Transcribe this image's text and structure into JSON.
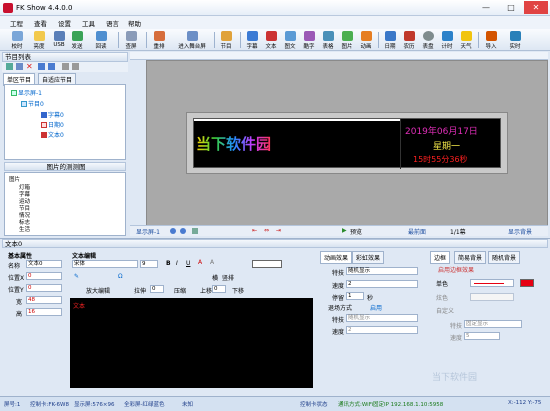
{
  "window": {
    "title": "FK Show 4.4.0.0",
    "min": "—",
    "max": "□",
    "close": "✕"
  },
  "menu": [
    "工程",
    "查看",
    "设置",
    "工具",
    "语言",
    "帮助"
  ],
  "toolbar": [
    "校时",
    "亮度",
    "USB",
    "发送",
    "回读",
    "查屏",
    "重排",
    "进入舞台屏",
    "节目",
    "字幕",
    "文本",
    "图文",
    "酷字",
    "表格",
    "图片",
    "动画",
    "日期",
    "农历",
    "表盘",
    "计时",
    "天气",
    "导入",
    "实时"
  ],
  "left_panel": {
    "title": "节目列表",
    "tabs": [
      "单区节目",
      "自适应节目"
    ]
  },
  "tree": {
    "root": "显示屏-1",
    "program": "节目0",
    "items": [
      "字幕0",
      "日期0",
      "文本0"
    ]
  },
  "list2": {
    "title": "图片的测测图",
    "root": "图片",
    "items": [
      "灯箱",
      "字幕",
      "运动",
      "节目",
      "情况",
      "标志",
      "生活",
      "其他"
    ]
  },
  "screen": {
    "main_text": "当下软件园",
    "date": "2019年06月17日",
    "weekday": "星期一",
    "time": "15时55分36秒"
  },
  "canvas_bar": {
    "screen_label": "显示屏-1",
    "preview": "预览",
    "page": "1/1幕",
    "bg": "显示背景",
    "front": "最前面"
  },
  "text_panel": {
    "title": "文本0",
    "basic": "基本属性",
    "name_label": "名称",
    "name_value": "文本0",
    "pos_x_label": "位置X",
    "pos_x": "0",
    "pos_y_label": "位置Y",
    "pos_y": "0",
    "width_label": "宽",
    "width": "48",
    "height_label": "高",
    "height": "16"
  },
  "editor": {
    "title": "文本编辑",
    "font": "宋体",
    "size": "9",
    "bg_label": "横",
    "flip": "竖排",
    "expand": "放大编辑",
    "stretch": "拉伸",
    "shrink": "压缩",
    "up": "上移",
    "down": "下移",
    "val0": "0",
    "val1": "0",
    "content": "文本"
  },
  "effects": {
    "tabs": [
      "动画效果",
      "彩虹效果"
    ],
    "effect_label": "特技",
    "effect_value": "随机显示",
    "speed_label": "速度",
    "speed_value": "2",
    "stay_label": "停留",
    "stay_value": "1",
    "stay_unit": "秒",
    "exit_label": "退场方式",
    "exit_enable": "启用",
    "exit_effect_label": "特技",
    "exit_effect": "随机显示",
    "exit_speed_label": "速度",
    "exit_speed": "2"
  },
  "border": {
    "tabs": [
      "边框",
      "简易背景",
      "随机背景"
    ],
    "enable": "启用边框效果",
    "single": "单色",
    "color": "炫色",
    "custom": "自定义",
    "effect_label": "特技",
    "effect": "固定显示",
    "speed_label": "速度",
    "speed": "5",
    "accent": "#e60012"
  },
  "status": {
    "screen": "屏号:1",
    "card": "控制卡:FK-6W8",
    "display": "显示屏:576×96",
    "color": "全彩屏-红绿蓝色",
    "unknown": "未知",
    "ctrl": "控制卡状态",
    "comm": "通讯方式:WiFi固定IP 192.168.1.10:5958",
    "coords": "X:-112 Y:-75"
  },
  "watermark": "当下软件园"
}
